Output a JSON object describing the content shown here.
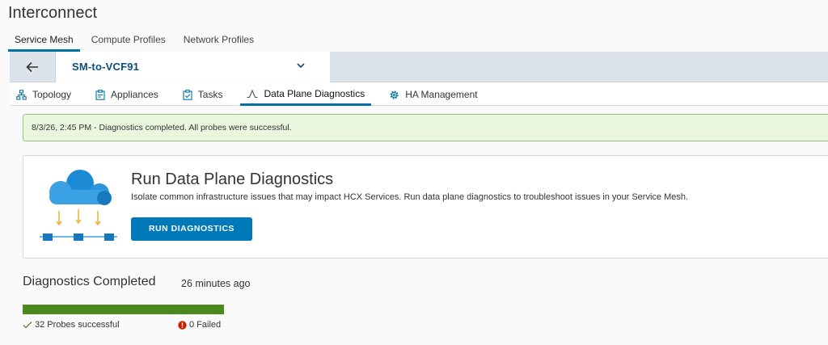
{
  "app": {
    "title": "Interconnect"
  },
  "top_tabs": [
    {
      "label": "Service Mesh",
      "active": true
    },
    {
      "label": "Compute Profiles",
      "active": false
    },
    {
      "label": "Network Profiles",
      "active": false
    }
  ],
  "selector": {
    "value": "SM-to-VCF91"
  },
  "sub_tabs": [
    {
      "label": "Topology",
      "icon": "topology-icon"
    },
    {
      "label": "Appliances",
      "icon": "clipboard-icon"
    },
    {
      "label": "Tasks",
      "icon": "clipboard-check-icon"
    },
    {
      "label": "Data Plane Diagnostics",
      "icon": "waveform-icon",
      "active": true
    },
    {
      "label": "HA Management",
      "icon": "gear-icon"
    }
  ],
  "alert": {
    "message": "8/3/26, 2:45 PM - Diagnostics completed. All probes were successful."
  },
  "card": {
    "title": "Run Data Plane Diagnostics",
    "description": "Isolate common infrastructure issues that may impact HCX Services. Run data plane diagnostics to troubleshoot issues in your Service Mesh.",
    "button_label": "RUN DIAGNOSTICS"
  },
  "diagnostics": {
    "title": "Diagnostics Completed",
    "time_ago": "26 minutes ago",
    "progress_percent": 100,
    "success_text": "32 Probes successful",
    "failed_text": "0 Failed"
  },
  "colors": {
    "accent": "#0079b8",
    "success_bar": "#4a8a1e",
    "alert_bg": "#eaf6dd",
    "error": "#c92100"
  }
}
